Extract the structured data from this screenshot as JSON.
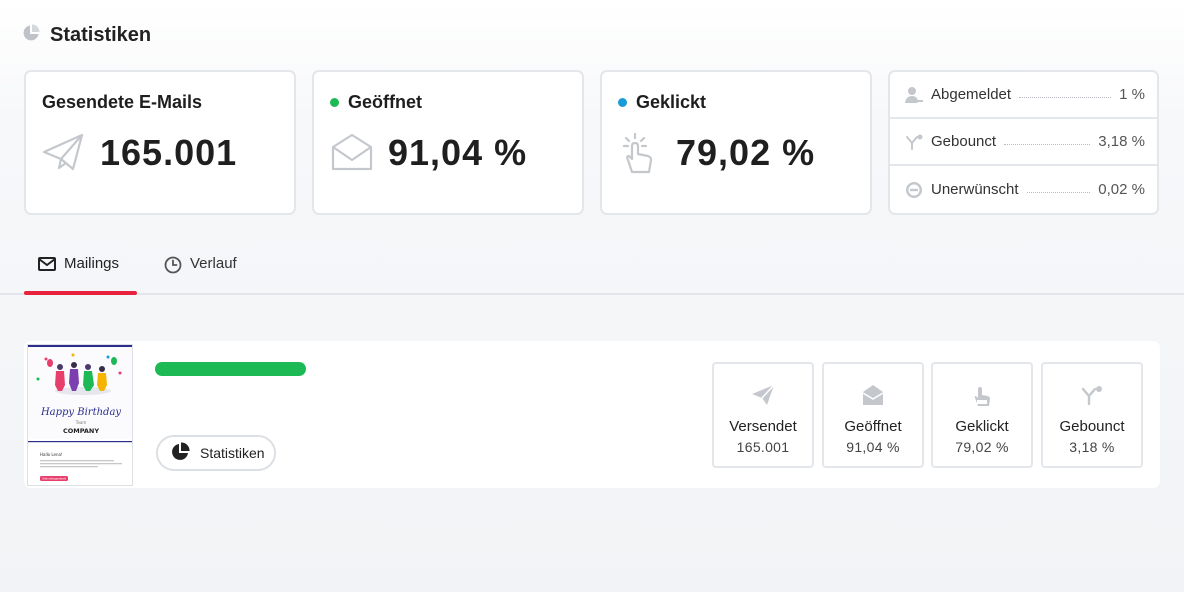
{
  "header": {
    "title": "Statistiken",
    "icon": "pie-chart-icon"
  },
  "summary": {
    "sent": {
      "title": "Gesendete E-Mails",
      "value": "165.001",
      "icon": "paper-plane-icon"
    },
    "opened": {
      "title": "Geöffnet",
      "value": "91,04 %",
      "icon": "envelope-open-icon",
      "dot_color": "#1db954"
    },
    "clicked": {
      "title": "Geklickt",
      "value": "79,02 %",
      "icon": "hand-click-icon",
      "dot_color": "#1a9bd7"
    }
  },
  "side": {
    "unsubscribed": {
      "label": "Abgemeldet",
      "value": "1 %",
      "icon": "user-minus-icon"
    },
    "bounced": {
      "label": "Gebounct",
      "value": "3,18 %",
      "icon": "bounce-icon"
    },
    "spam": {
      "label": "Unerwünscht",
      "value": "0,02 %",
      "icon": "block-icon"
    }
  },
  "tabs": [
    {
      "label": "Mailings",
      "icon": "mail-icon",
      "active": true
    },
    {
      "label": "Verlauf",
      "icon": "clock-icon",
      "active": false
    }
  ],
  "mailing": {
    "thumbnail": {
      "heading": "Happy Birthday",
      "sub": "Team",
      "company": "COMPANY",
      "greeting": "Hallo Lena!",
      "button": "Geburtstagsrabatt"
    },
    "stats_button": "Statistiken",
    "metrics": [
      {
        "label": "Versendet",
        "value": "165.001",
        "icon": "paper-plane-icon"
      },
      {
        "label": "Geöffnet",
        "value": "91,04 %",
        "icon": "envelope-icon"
      },
      {
        "label": "Geklickt",
        "value": "79,02 %",
        "icon": "hand-click-icon"
      },
      {
        "label": "Gebounct",
        "value": "3,18 %",
        "icon": "bounce-icon"
      }
    ]
  },
  "colors": {
    "accent_red": "#e8213c",
    "green": "#1db954",
    "blue": "#1a9bd7"
  }
}
